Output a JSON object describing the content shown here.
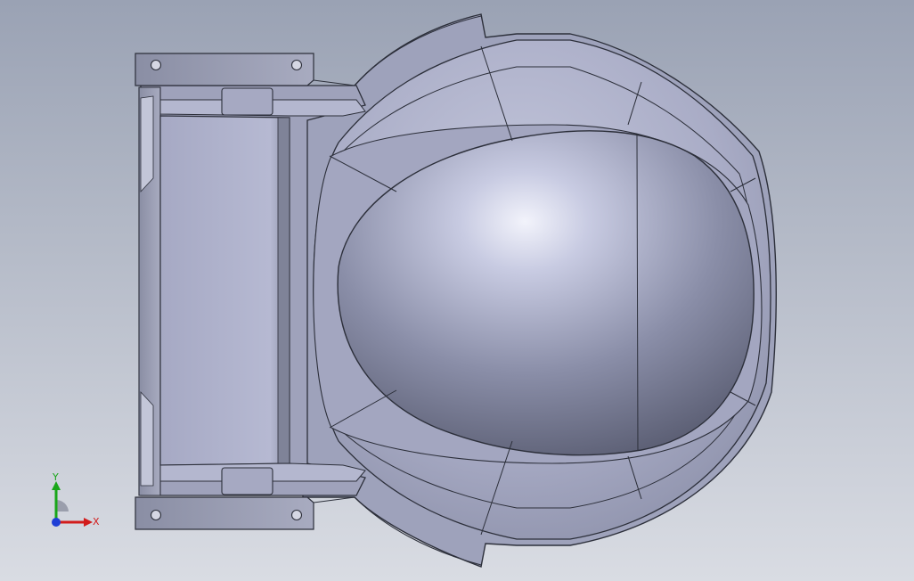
{
  "colors": {
    "background_top": "#9aa2b4",
    "background_bottom": "#d9dce3",
    "model_outline": "#2c2f3a",
    "model_face": "#aeb2c8",
    "axis_x": "#d21c1c",
    "axis_y": "#19a619",
    "axis_z": "#1f3fd6"
  },
  "triad": {
    "x_label": "X",
    "y_label": "Y"
  }
}
